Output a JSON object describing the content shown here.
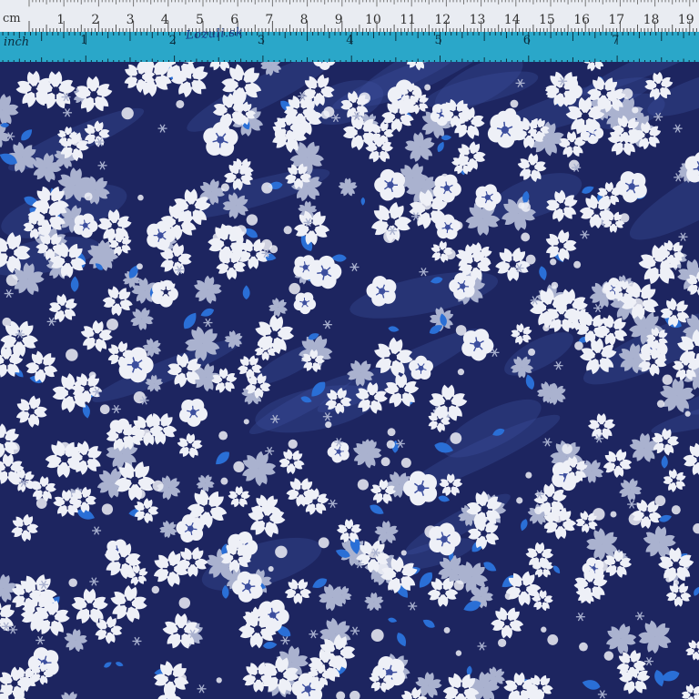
{
  "ruler": {
    "cm_unit": "cm",
    "inch_unit": "inch",
    "brand": "Lozuli.sk",
    "cm_numbers": [
      "1",
      "2",
      "3",
      "4",
      "5",
      "6",
      "7",
      "8",
      "9",
      "10",
      "11",
      "12",
      "13",
      "14",
      "15",
      "16",
      "17",
      "18",
      "19",
      "2"
    ],
    "inch_numbers": [
      "1",
      "2",
      "3",
      "4",
      "5",
      "6",
      "7"
    ],
    "cm_color": "#e9ecf2",
    "inch_color": "#2aa7c9"
  },
  "fabric": {
    "description_colors": {
      "background": "#1d2560",
      "blossom_white": "#eef0f7",
      "blossom_shadow": "#aab2cf",
      "accent_blue": "#2a6fd6",
      "accent_mid": "#3d4f9e"
    }
  }
}
